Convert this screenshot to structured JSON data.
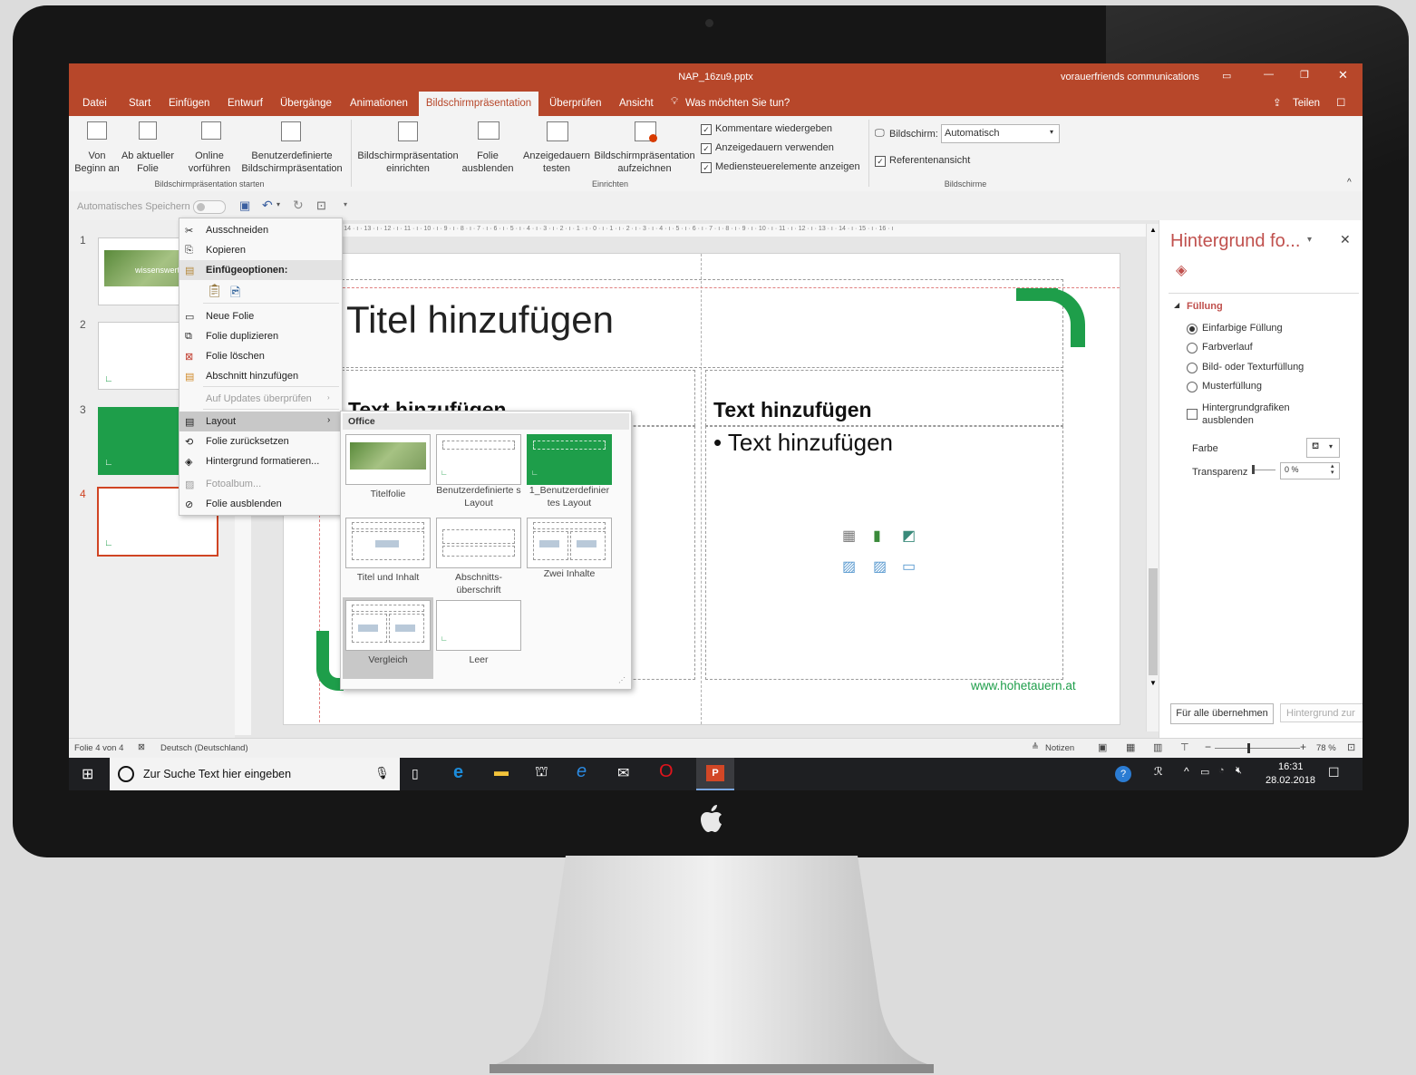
{
  "window": {
    "title": "NAP_16zu9.pptx",
    "account": "vorauerfriends communications",
    "share_label": "Teilen"
  },
  "ribbon": {
    "tabs": [
      "Datei",
      "Start",
      "Einfügen",
      "Entwurf",
      "Übergänge",
      "Animationen",
      "Bildschirmpräsentation",
      "Überprüfen",
      "Ansicht"
    ],
    "active_tab": "Bildschirmpräsentation",
    "tell_me": "Was möchten Sie tun?",
    "buttons": {
      "von_beginn_1": "Von",
      "von_beginn_2": "Beginn an",
      "ab_aktueller_1": "Ab aktueller",
      "ab_aktueller_2": "Folie",
      "online_1": "Online",
      "online_2": "vorführen",
      "benutzer_1": "Benutzerdefinierte",
      "benutzer_2": "Bildschirmpräsentation",
      "einrichten_1": "Bildschirmpräsentation",
      "einrichten_2": "einrichten",
      "ausblenden_1": "Folie",
      "ausblenden_2": "ausblenden",
      "testen_1": "Anzeigedauern",
      "testen_2": "testen",
      "aufzeichnen_1": "Bildschirmpräsentation",
      "aufzeichnen_2": "aufzeichnen"
    },
    "checkboxes": {
      "kommentare": "Kommentare wiedergeben",
      "anzeigedauern": "Anzeigedauern verwenden",
      "mediensteuer": "Mediensteuerelemente anzeigen",
      "referenten": "Referentenansicht"
    },
    "bildschirm_label": "Bildschirm:",
    "bildschirm_value": "Automatisch",
    "groups": {
      "starten": "Bildschirmpräsentation starten",
      "einrichten": "Einrichten",
      "bildschirme": "Bildschirme"
    }
  },
  "qat": {
    "autosave": "Automatisches Speichern"
  },
  "thumbnails": [
    "1",
    "2",
    "3",
    "4"
  ],
  "thumb1_text": "wissenswert",
  "ruler_h": "· 14 · ı · 13 · ı · 12 · ı · 11 · ı · 10 · ı · 9 · ı · 8 · ı · 7 · ı · 6 · ı · 5 · ı · 4 · ı · 3 · ı · 2 · ı · 1 · ı · 0 · ı · 1 · ı · 2 · ı · 3 · ı · 4 · ı · 5 · ı · 6 · ı · 7 · ı · 8 · ı · 9 · ı · 10 · ı · 11 · ı · 12 · ı · 13 · ı · 14 · ı · 15 · ı · 16 · ı",
  "slide": {
    "title": "Titel hinzufügen",
    "left_heading": "Text hinzufügen",
    "right_heading": "Text hinzufügen",
    "right_bullet": "• Text hinzufügen",
    "url": "www.hohetauern.at",
    "accent_color": "#1e9e4a"
  },
  "context_menu": {
    "items": [
      "Ausschneiden",
      "Kopieren",
      "Einfügeoptionen:",
      "Neue Folie",
      "Folie duplizieren",
      "Folie löschen",
      "Abschnitt hinzufügen",
      "Auf Updates überprüfen",
      "Layout",
      "Folie zurücksetzen",
      "Hintergrund formatieren...",
      "Fotoalbum...",
      "Folie ausblenden"
    ]
  },
  "layout_menu": {
    "header": "Office",
    "layouts": [
      "Titelfolie",
      "Benutzerdefinierte s Layout",
      "1_Benutzerdefinier tes Layout",
      "Titel und Inhalt",
      "Abschnitts- überschrift",
      "Zwei Inhalte",
      "Vergleich",
      "Leer"
    ]
  },
  "format_pane": {
    "title": "Hintergrund fo...",
    "section": "Füllung",
    "options": [
      "Einfarbige Füllung",
      "Farbverlauf",
      "Bild- oder Texturfüllung",
      "Musterfüllung"
    ],
    "hide_graphics": "Hintergrundgrafiken ausblenden",
    "farbe": "Farbe",
    "transparenz": "Transparenz",
    "transparenz_value": "0 %",
    "apply_all": "Für alle übernehmen",
    "reset": "Hintergrund zur"
  },
  "statusbar": {
    "slide_info": "Folie 4 von 4",
    "language": "Deutsch (Deutschland)",
    "notes": "Notizen",
    "zoom": "78 %"
  },
  "taskbar": {
    "search": "Zur Suche Text hier eingeben",
    "time": "16:31",
    "date": "28.02.2018"
  },
  "colors": {
    "ppt_red": "#b7472a",
    "accent_green": "#1e9e4a",
    "taskbar": "#1e1f22"
  }
}
